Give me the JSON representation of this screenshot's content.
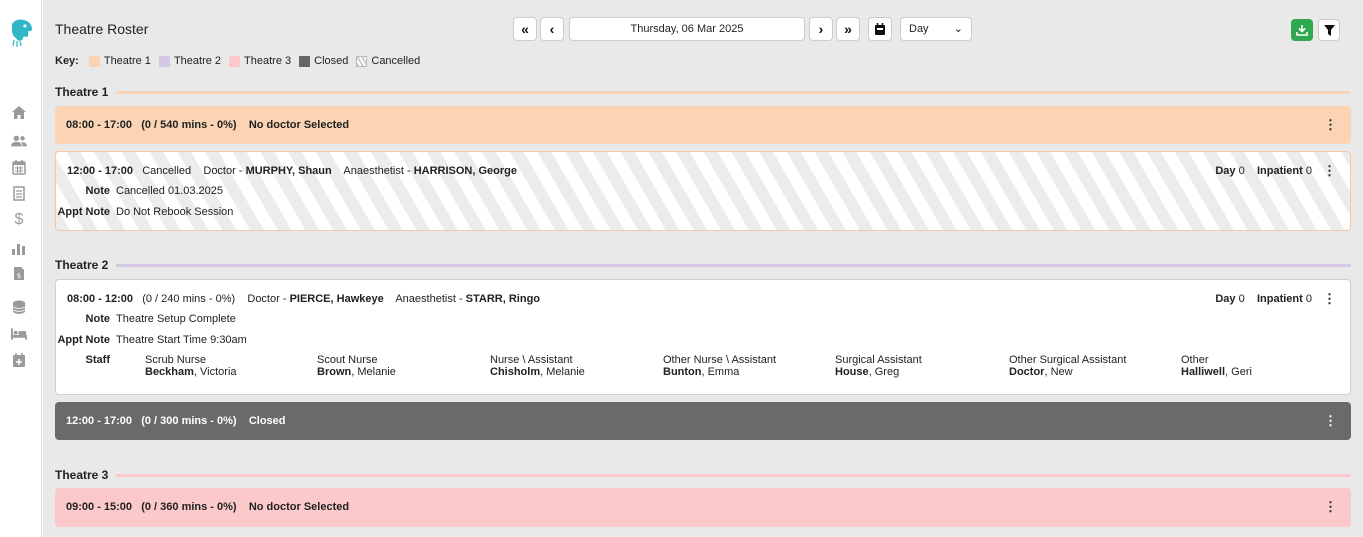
{
  "app": {
    "title": "Theatre Roster"
  },
  "nav": {
    "first": "«",
    "prev": "‹",
    "date": "Thursday, 06 Mar 2025",
    "next": "›",
    "last": "»",
    "view": "Day"
  },
  "key": {
    "label": "Key:",
    "items": [
      {
        "label": "Theatre 1",
        "color": "#fad4b4"
      },
      {
        "label": "Theatre 2",
        "color": "#d5c8e2"
      },
      {
        "label": "Theatre 3",
        "color": "#fcc9cb"
      },
      {
        "label": "Closed",
        "color": "#666666"
      },
      {
        "label": "Cancelled",
        "color": "hatched"
      }
    ]
  },
  "theatres": [
    {
      "name": "Theatre 1",
      "line_color": "#fad4b4",
      "sessions": [
        {
          "time": "08:00 - 17:00",
          "mins": "(0 / 540 mins - 0%)",
          "doctor": "No doctor Selected"
        },
        {
          "time": "12:00 - 17:00",
          "status": "Cancelled",
          "doctor_label": "Doctor - ",
          "doctor": "MURPHY, Shaun",
          "anaes_label": "Anaesthetist - ",
          "anaes": "HARRISON, George",
          "day_label": "Day",
          "day": "0",
          "inpatient_label": "Inpatient",
          "inpatient": "0",
          "note_label": "Note",
          "note": "Cancelled 01.03.2025",
          "appt_label": "Appt Note",
          "appt": "Do Not Rebook Session"
        }
      ]
    },
    {
      "name": "Theatre 2",
      "line_color": "#d5c8e2",
      "sessions": [
        {
          "time": "08:00 - 12:00",
          "mins": "(0 / 240 mins - 0%)",
          "doctor_label": "Doctor - ",
          "doctor": "PIERCE, Hawkeye",
          "anaes_label": "Anaesthetist - ",
          "anaes": "STARR, Ringo",
          "day_label": "Day",
          "day": "0",
          "inpatient_label": "Inpatient",
          "inpatient": "0",
          "note_label": "Note",
          "note": "Theatre Setup Complete",
          "appt_label": "Appt Note",
          "appt": "Theatre Start Time 9:30am",
          "staff_label": "Staff",
          "staff": [
            {
              "role": "Scrub Nurse",
              "last": "Beckham",
              "first": ", Victoria"
            },
            {
              "role": "Scout Nurse",
              "last": "Brown",
              "first": ", Melanie"
            },
            {
              "role": "Nurse \\ Assistant",
              "last": "Chisholm",
              "first": ", Melanie"
            },
            {
              "role": "Other Nurse \\ Assistant",
              "last": "Bunton",
              "first": ", Emma"
            },
            {
              "role": "Surgical Assistant",
              "last": "House",
              "first": ", Greg"
            },
            {
              "role": "Other Surgical Assistant",
              "last": "Doctor",
              "first": ", New"
            },
            {
              "role": "Other",
              "last": "Halliwell",
              "first": ", Geri"
            }
          ]
        },
        {
          "time": "12:00 - 17:00",
          "mins": "(0 / 300 mins - 0%)",
          "status": "Closed"
        }
      ]
    },
    {
      "name": "Theatre 3",
      "line_color": "#fcc9cb",
      "sessions": [
        {
          "time": "09:00 - 15:00",
          "mins": "(0 / 360 mins - 0%)",
          "doctor": "No doctor Selected"
        }
      ]
    }
  ]
}
